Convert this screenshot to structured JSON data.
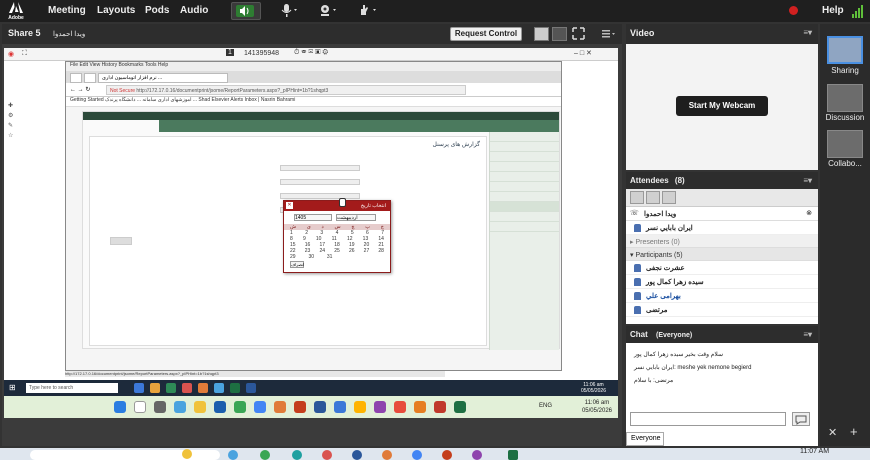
{
  "menubar": {
    "logo": "Adobe",
    "items": [
      "Meeting",
      "Layouts",
      "Pods",
      "Audio"
    ],
    "help": "Help"
  },
  "share": {
    "title": "Share 5",
    "presenter": "ويدا احمدوا",
    "request_control": "Request Control"
  },
  "remote": {
    "meeting_id": "141395948",
    "browser_menu": "File  Edit  View  History  Bookmarks  Tools  Help",
    "tab_label": "نرم افزار اتوماسیون اداری ...",
    "not_secure": "Not Secure",
    "address": "http://172.17.0.16/documentprint/jsome/ReportParameters.aspx?_pIPHint=1b?1shqpt3",
    "bookmarks": "Getting Started  آموزشهای اداری  سامانه ... دانشگاه پرندک  ...  Shad  Elsevier Alerts  Inbox | Nasrin Bahrami",
    "form_title": "گزارش های پرسنل",
    "datepicker": {
      "title": "انتخاب تاریخ",
      "month": "اردیبهشت",
      "year": "1405",
      "close": "انصراف",
      "weekdays": [
        "ش",
        "ی",
        "د",
        "س",
        "چ",
        "پ",
        "ج"
      ],
      "weeks": [
        [
          "1",
          "2",
          "3",
          "4",
          "5",
          "6",
          "7"
        ],
        [
          "8",
          "9",
          "10",
          "11",
          "12",
          "13",
          "14"
        ],
        [
          "15",
          "16",
          "17",
          "18",
          "19",
          "20",
          "21"
        ],
        [
          "22",
          "23",
          "24",
          "25",
          "26",
          "27",
          "28"
        ],
        [
          "29",
          "30",
          "31",
          "",
          "",
          "",
          ""
        ]
      ]
    },
    "inner_search": "Type here to search",
    "inner_time": "11:06 am",
    "inner_date": "05/05/2026",
    "host_time": "11:06 am",
    "host_date": "05/05/2026",
    "host_lang": "ENG"
  },
  "video": {
    "title": "Video",
    "webcam_button": "Start My Webcam"
  },
  "attendees": {
    "title": "Attendees",
    "count": "(8)",
    "status_name": "ويدا احمدوا",
    "host_name": "ايران بابايي نسر",
    "presenters_label": "Presenters (0)",
    "participants_label": "Participants (5)",
    "participants": [
      "عشرت نجفی",
      "سيده زهرا کمال پور",
      "بهرامى علي",
      "مرتضى"
    ]
  },
  "chat": {
    "title": "Chat",
    "audience": "(Everyone)",
    "messages": [
      "سلام وقت بخير سيده زهرا کمال پور",
      "ايران بابايي نسر: meshe yek nemone begierd",
      "مرتضى: با سلام"
    ],
    "tab": "Everyone"
  },
  "layouts": {
    "items": [
      "Sharing",
      "Discussion",
      "Collabo..."
    ]
  },
  "host_taskbar": {
    "time": "11:07 AM"
  },
  "colors": {
    "menubar": "#1f1f1f",
    "accent_red": "#a31b1b",
    "participant_blue": "#1a4fa0"
  }
}
